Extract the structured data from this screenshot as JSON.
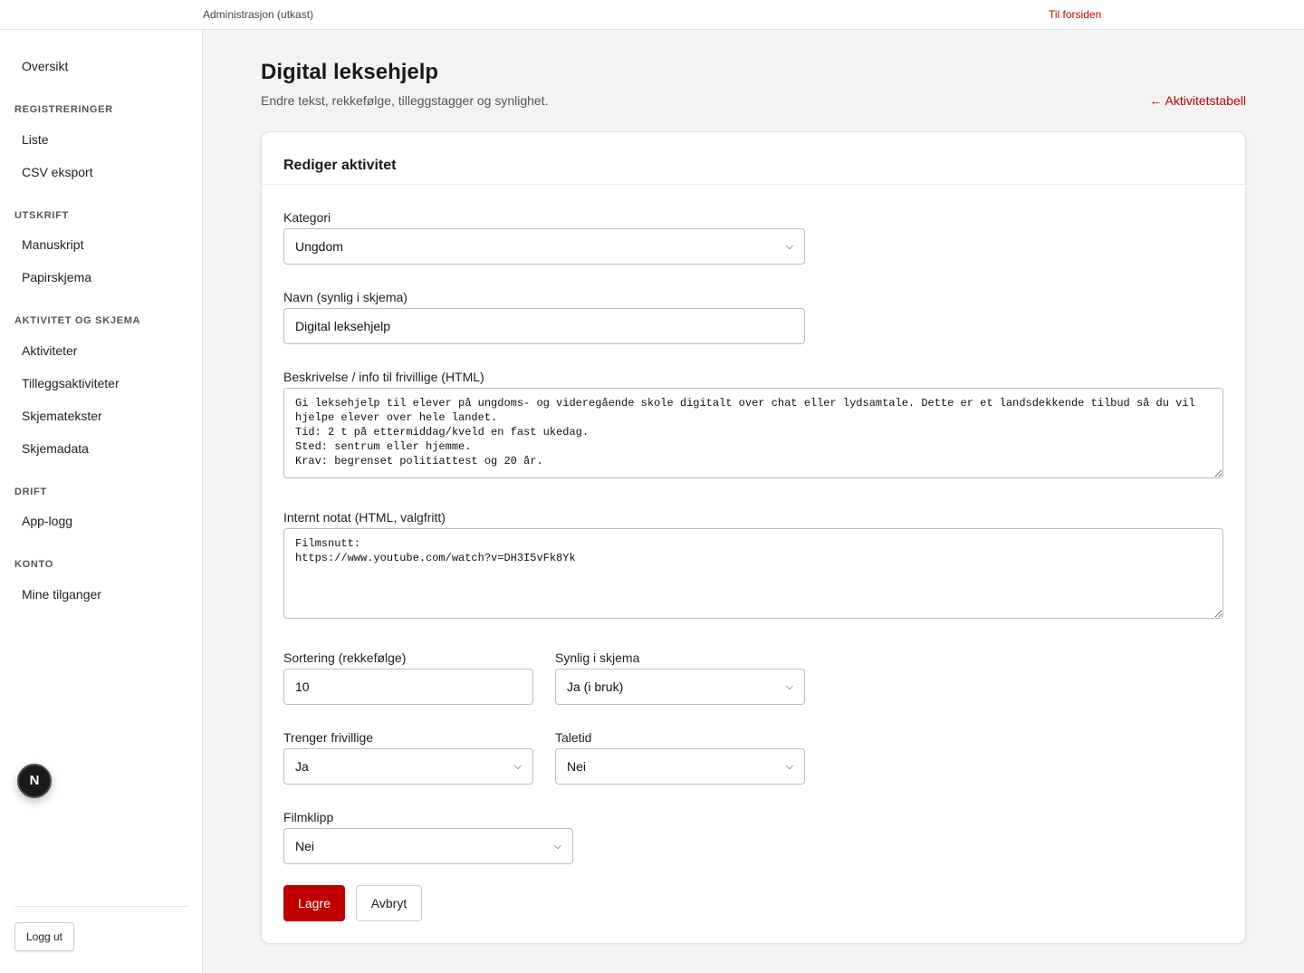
{
  "topbar": {
    "title": "Administrasjon (utkast)",
    "home_link": "Til forsiden"
  },
  "sidebar": {
    "overview": "Oversikt",
    "sections": [
      {
        "heading": "REGISTRERINGER",
        "items": [
          "Liste",
          "CSV eksport"
        ]
      },
      {
        "heading": "UTSKRIFT",
        "items": [
          "Manuskript",
          "Papirskjema"
        ]
      },
      {
        "heading": "AKTIVITET OG SKJEMA",
        "items": [
          "Aktiviteter",
          "Tilleggsaktiviteter",
          "Skjematekster",
          "Skjemadata"
        ]
      },
      {
        "heading": "DRIFT",
        "items": [
          "App-logg"
        ]
      },
      {
        "heading": "KONTO",
        "items": [
          "Mine tilganger"
        ]
      }
    ],
    "logout_label": "Logg ut"
  },
  "dev_badge": {
    "letter": "N"
  },
  "page": {
    "title": "Digital leksehjelp",
    "subtitle": "Endre tekst, rekkefølge, tilleggstagger og synlighet.",
    "back_link": "← Aktivitetstabell"
  },
  "form": {
    "card_title": "Rediger aktivitet",
    "category": {
      "label": "Kategori",
      "value": "Ungdom"
    },
    "name": {
      "label": "Navn (synlig i skjema)",
      "value": "Digital leksehjelp"
    },
    "description": {
      "label": "Beskrivelse / info til frivillige (HTML)",
      "value": "Gi leksehjelp til elever på ungdoms- og videregående skole digitalt over chat eller lydsamtale. Dette er et landsdekkende tilbud så du vil hjelpe elever over hele landet.\nTid: 2 t på ettermiddag/kveld en fast ukedag.\nSted: sentrum eller hjemme.\nKrav: begrenset politiattest og 20 år."
    },
    "internal_note": {
      "label": "Internt notat (HTML, valgfritt)",
      "value": "Filmsnutt:\nhttps://www.youtube.com/watch?v=DH3I5vFk8Yk"
    },
    "sort_order": {
      "label": "Sortering (rekkefølge)",
      "value": "10"
    },
    "visible": {
      "label": "Synlig i skjema",
      "value": "Ja (i bruk)"
    },
    "needs_volunteers": {
      "label": "Trenger frivillige",
      "value": "Ja"
    },
    "speaking_time": {
      "label": "Taletid",
      "value": "Nei"
    },
    "film_clip": {
      "label": "Filmklipp",
      "value": "Nei"
    },
    "save_label": "Lagre",
    "cancel_label": "Avbryt"
  },
  "icons": {
    "select_arrow": "chevron-down-icon"
  },
  "colors": {
    "accent": "#c00000",
    "background": "#f3f3f3"
  }
}
